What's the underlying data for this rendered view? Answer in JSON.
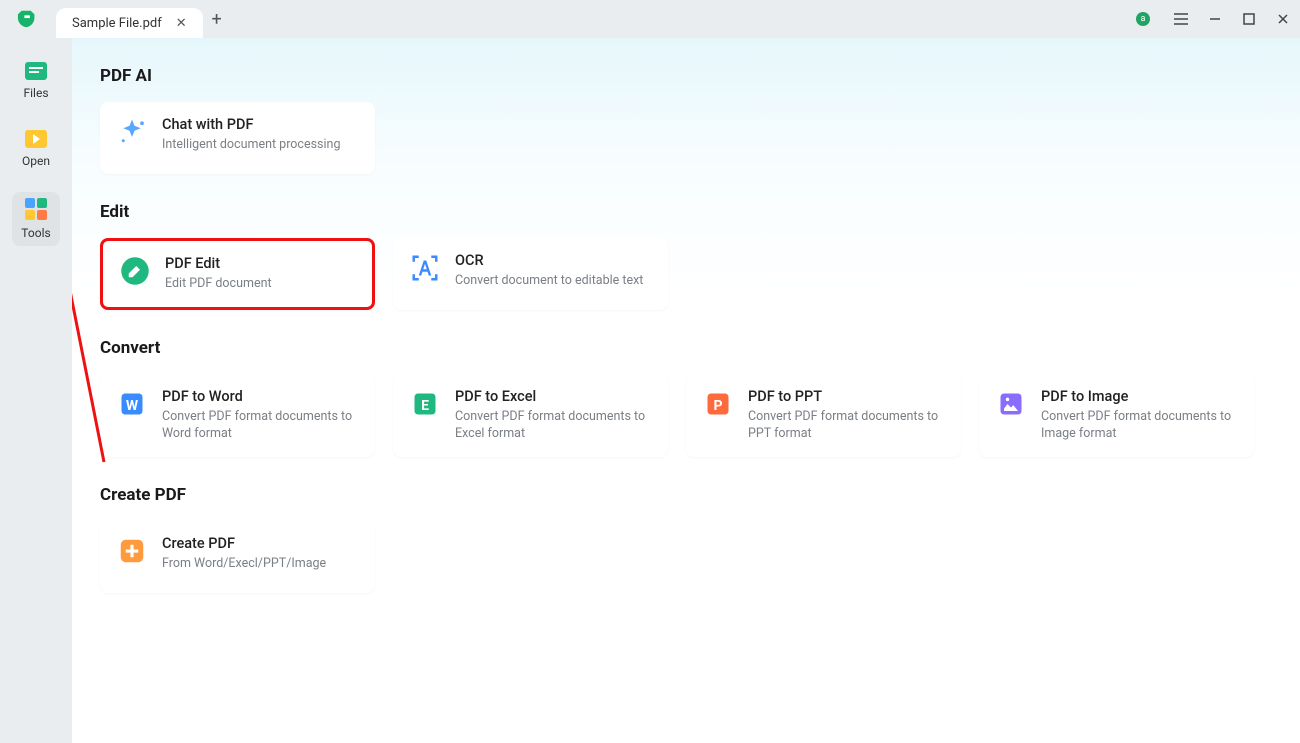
{
  "titlebar": {
    "tab_label": "Sample File.pdf",
    "user_initial": "a"
  },
  "sidebar": {
    "items": [
      {
        "label": "Files"
      },
      {
        "label": "Open"
      },
      {
        "label": "Tools"
      }
    ]
  },
  "sections": {
    "pdf_ai": {
      "title": "PDF AI",
      "chat": {
        "title": "Chat with PDF",
        "desc": "Intelligent document processing"
      }
    },
    "edit": {
      "title": "Edit",
      "pdf_edit": {
        "title": "PDF Edit",
        "desc": "Edit PDF document"
      },
      "ocr": {
        "title": "OCR",
        "desc": "Convert document to editable text"
      }
    },
    "convert": {
      "title": "Convert",
      "word": {
        "title": "PDF to Word",
        "desc": "Convert PDF format documents to Word format"
      },
      "excel": {
        "title": "PDF to Excel",
        "desc": "Convert PDF format documents to Excel format"
      },
      "ppt": {
        "title": "PDF to PPT",
        "desc": "Convert PDF format documents to PPT format"
      },
      "image": {
        "title": "PDF to Image",
        "desc": "Convert PDF format documents to Image format"
      }
    },
    "create": {
      "title": "Create PDF",
      "create": {
        "title": "Create PDF",
        "desc": "From Word/Execl/PPT/Image"
      }
    }
  }
}
